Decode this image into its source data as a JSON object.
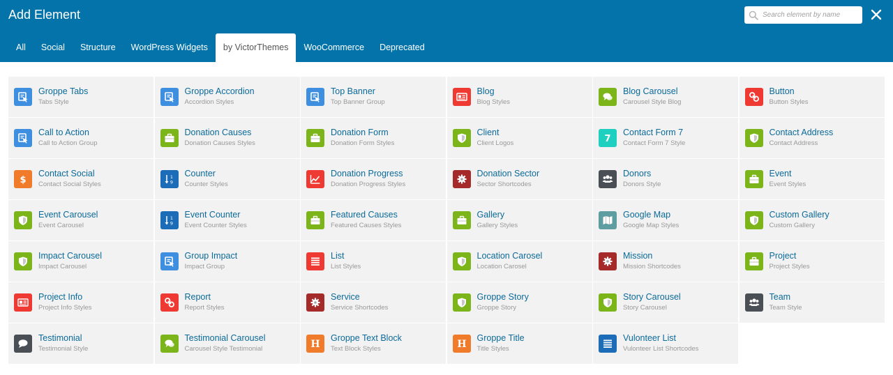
{
  "header": {
    "title": "Add Element",
    "search_placeholder": "Search element by name",
    "bg_color": "#0473aa"
  },
  "tabs": [
    {
      "label": "All",
      "active": false
    },
    {
      "label": "Social",
      "active": false
    },
    {
      "label": "Structure",
      "active": false
    },
    {
      "label": "WordPress Widgets",
      "active": false
    },
    {
      "label": "by VictorThemes",
      "active": true
    },
    {
      "label": "WooCommerce",
      "active": false
    },
    {
      "label": "Deprecated",
      "active": false
    }
  ],
  "elements": [
    {
      "name": "Groppe Tabs",
      "desc": "Tabs Style",
      "icon": "pointer-icon",
      "color": "#3f8fe0"
    },
    {
      "name": "Groppe Accordion",
      "desc": "Accordion Styles",
      "icon": "pointer-icon",
      "color": "#3f8fe0"
    },
    {
      "name": "Top Banner",
      "desc": "Top Banner Group",
      "icon": "pointer-icon",
      "color": "#3f8fe0"
    },
    {
      "name": "Blog",
      "desc": "Blog Styles",
      "icon": "id-card-icon",
      "color": "#ee3a33"
    },
    {
      "name": "Blog Carousel",
      "desc": "Carousel Style Blog",
      "icon": "chat-icon",
      "color": "#7cb519"
    },
    {
      "name": "Button",
      "desc": "Button Styles",
      "icon": "link-icon",
      "color": "#ee3a33"
    },
    {
      "name": "Call to Action",
      "desc": "Call to Action Group",
      "icon": "pointer-icon",
      "color": "#3f8fe0"
    },
    {
      "name": "Donation Causes",
      "desc": "Donation Causes Styles",
      "icon": "briefcase-icon",
      "color": "#7cb519"
    },
    {
      "name": "Donation Form",
      "desc": "Donation Form Styles",
      "icon": "briefcase-icon",
      "color": "#7cb519"
    },
    {
      "name": "Client",
      "desc": "Client Logos",
      "icon": "shield-icon",
      "color": "#7cb519"
    },
    {
      "name": "Contact Form 7",
      "desc": "Contact Form 7 Style",
      "icon": "seven-icon",
      "color": "#1fcfbf"
    },
    {
      "name": "Contact Address",
      "desc": "Contact Address",
      "icon": "shield-icon",
      "color": "#7cb519"
    },
    {
      "name": "Contact Social",
      "desc": "Contact Social Styles",
      "icon": "dollar-icon",
      "color": "#f07b2b"
    },
    {
      "name": "Counter",
      "desc": "Counter Styles",
      "icon": "sort-numeric-icon",
      "color": "#1c6cb8"
    },
    {
      "name": "Donation Progress",
      "desc": "Donation Progress Styles",
      "icon": "area-chart-icon",
      "color": "#ee3a33"
    },
    {
      "name": "Donation Sector",
      "desc": "Sector Shortcodes",
      "icon": "gear-icon",
      "color": "#a52a2a"
    },
    {
      "name": "Donors",
      "desc": "Donors Style",
      "icon": "users-icon",
      "color": "#4a4f55"
    },
    {
      "name": "Event",
      "desc": "Event Styles",
      "icon": "briefcase-icon",
      "color": "#7cb519"
    },
    {
      "name": "Event Carousel",
      "desc": "Event Carousel",
      "icon": "shield-icon",
      "color": "#7cb519"
    },
    {
      "name": "Event Counter",
      "desc": "Event Counter Styles",
      "icon": "sort-numeric-icon",
      "color": "#1c6cb8"
    },
    {
      "name": "Featured Causes",
      "desc": "Featured Causes Styles",
      "icon": "briefcase-icon",
      "color": "#7cb519"
    },
    {
      "name": "Gallery",
      "desc": "Gallery Styles",
      "icon": "briefcase-icon",
      "color": "#7cb519"
    },
    {
      "name": "Google Map",
      "desc": "Google Map Styles",
      "icon": "map-icon",
      "color": "#5e9ea0"
    },
    {
      "name": "Custom Gallery",
      "desc": "Custom Gallery",
      "icon": "shield-icon",
      "color": "#7cb519"
    },
    {
      "name": "Impact Carousel",
      "desc": "Impact Carousel",
      "icon": "shield-icon",
      "color": "#7cb519"
    },
    {
      "name": "Group Impact",
      "desc": "Impact Group",
      "icon": "pointer-icon",
      "color": "#3f8fe0"
    },
    {
      "name": "List",
      "desc": "List Styles",
      "icon": "list-icon",
      "color": "#ee3a33"
    },
    {
      "name": "Location Carosel",
      "desc": "Location Carosel",
      "icon": "shield-icon",
      "color": "#7cb519"
    },
    {
      "name": "Mission",
      "desc": "Mission Shortcodes",
      "icon": "gear-icon",
      "color": "#a52a2a"
    },
    {
      "name": "Project",
      "desc": "Project Styles",
      "icon": "briefcase-icon",
      "color": "#7cb519"
    },
    {
      "name": "Project Info",
      "desc": "Project Info Styles",
      "icon": "id-card-icon",
      "color": "#ee3a33"
    },
    {
      "name": "Report",
      "desc": "Report Styles",
      "icon": "link-icon",
      "color": "#ee3a33"
    },
    {
      "name": "Service",
      "desc": "Service Shortcodes",
      "icon": "gear-icon",
      "color": "#a52a2a"
    },
    {
      "name": "Groppe Story",
      "desc": "Groppe Story",
      "icon": "shield-icon",
      "color": "#7cb519"
    },
    {
      "name": "Story Carousel",
      "desc": "Story Carousel",
      "icon": "shield-icon",
      "color": "#7cb519"
    },
    {
      "name": "Team",
      "desc": "Team Style",
      "icon": "users-icon",
      "color": "#4a4f55"
    },
    {
      "name": "Testimonial",
      "desc": "Testimonial Style",
      "icon": "comment-icon",
      "color": "#4a4f55"
    },
    {
      "name": "Testimonial Carousel",
      "desc": "Carousel Style Testimonial",
      "icon": "chat-icon",
      "color": "#7cb519"
    },
    {
      "name": "Groppe Text Block",
      "desc": "Text Block Styles",
      "icon": "heading-icon",
      "color": "#f07b2b"
    },
    {
      "name": "Groppe Title",
      "desc": "Title Styles",
      "icon": "heading-icon",
      "color": "#f07b2b"
    },
    {
      "name": "Vulonteer List",
      "desc": "Vulonteer List Shortcodes",
      "icon": "list-icon",
      "color": "#1c6cb8"
    }
  ]
}
